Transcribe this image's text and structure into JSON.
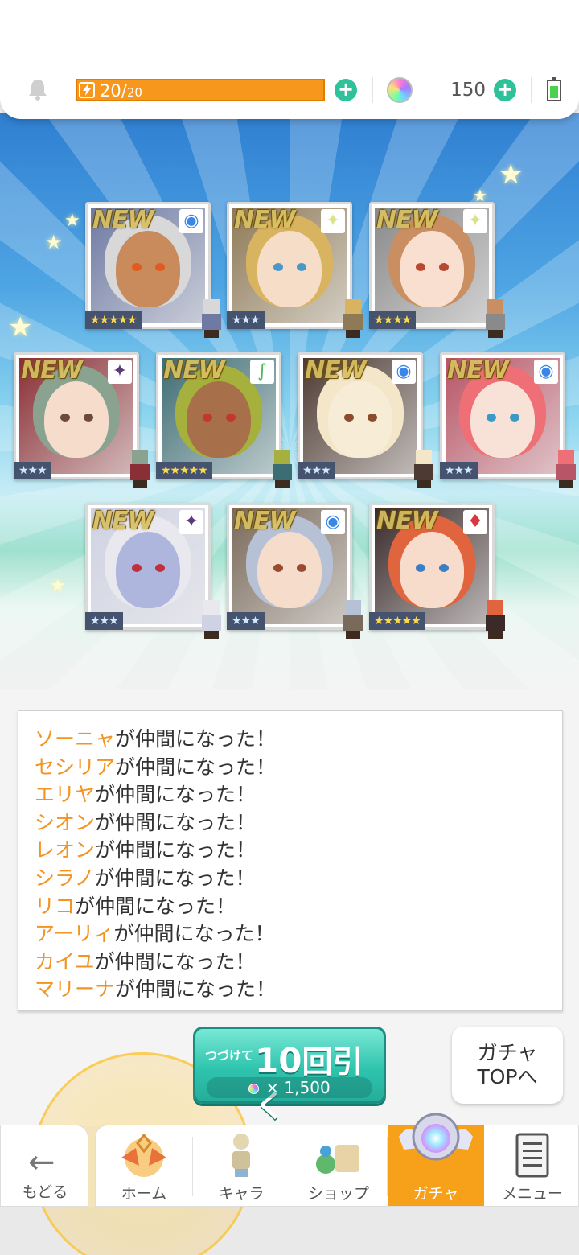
{
  "header": {
    "stamina_current": "20",
    "stamina_max": "20",
    "stamina_fraction": 1.0,
    "gem_count": "150",
    "icons": {
      "notification": "bell-icon",
      "stamina": "lightning-icon",
      "add_stamina": "plus-icon",
      "gem": "rainbow-gem-icon",
      "add_gem": "plus-icon",
      "battery": "battery-icon"
    },
    "colors": {
      "stamina_bar": "#f7981c",
      "plus": "#2fc29a",
      "battery": "#4bd14b"
    }
  },
  "results": {
    "cards": [
      {
        "new_label": "NEW",
        "stars": "★★★★★",
        "rarity": 5,
        "attribute": "circle-icon",
        "attr_glyph": "◉",
        "attr_color": "#3a86e8",
        "hair": "#d8d8d8",
        "skin": "#c98a5c",
        "eye": "#e35a20",
        "bg": "#6e7aa3"
      },
      {
        "new_label": "NEW",
        "stars": "★★★",
        "rarity": 3,
        "attribute": "sparkle-icon",
        "attr_glyph": "✦",
        "attr_color": "#dbe28a",
        "hair": "#d8b460",
        "skin": "#f6ddc8",
        "eye": "#4a98c9",
        "bg": "#8e7a57"
      },
      {
        "new_label": "NEW",
        "stars": "★★★★",
        "rarity": 4,
        "attribute": "sparkle-icon",
        "attr_glyph": "✦",
        "attr_color": "#dbe28a",
        "hair": "#c98e61",
        "skin": "#f8dfd0",
        "eye": "#b84830",
        "bg": "#8a8a8a"
      },
      {
        "new_label": "NEW",
        "stars": "★★★",
        "rarity": 3,
        "attribute": "star-purple-icon",
        "attr_glyph": "✦",
        "attr_color": "#5b3a7a",
        "hair": "#8aa391",
        "skin": "#f5dccb",
        "eye": "#6d4a3a",
        "bg": "#8a2f35"
      },
      {
        "new_label": "NEW",
        "stars": "★★★★★",
        "rarity": 5,
        "attribute": "leaf-icon",
        "attr_glyph": "∫",
        "attr_color": "#49b84e",
        "hair": "#a6b03c",
        "skin": "#a8704a",
        "eye": "#c0392b",
        "bg": "#3d6d74"
      },
      {
        "new_label": "NEW",
        "stars": "★★★",
        "rarity": 3,
        "attribute": "circle-icon",
        "attr_glyph": "◉",
        "attr_color": "#3a86e8",
        "hair": "#f3e6c9",
        "skin": "#f7ecd6",
        "eye": "#8c4a2e",
        "bg": "#4d3a32"
      },
      {
        "new_label": "NEW",
        "stars": "★★★",
        "rarity": 3,
        "attribute": "circle-icon",
        "attr_glyph": "◉",
        "attr_color": "#3a86e8",
        "hair": "#ef6f76",
        "skin": "#f8e2d8",
        "eye": "#3a99c5",
        "bg": "#b85566"
      },
      {
        "new_label": "NEW",
        "stars": "★★★",
        "rarity": 3,
        "attribute": "star-purple-icon",
        "attr_glyph": "✦",
        "attr_color": "#5b3a7a",
        "hair": "#e8e8ee",
        "skin": "#aeb6dd",
        "eye": "#c0303c",
        "bg": "#cfd2e2"
      },
      {
        "new_label": "NEW",
        "stars": "★★★",
        "rarity": 3,
        "attribute": "circle-icon",
        "attr_glyph": "◉",
        "attr_color": "#3a86e8",
        "hair": "#b7c1d6",
        "skin": "#f6dccb",
        "eye": "#9a4a30",
        "bg": "#7a6a5a"
      },
      {
        "new_label": "NEW",
        "stars": "★★★★★",
        "rarity": 5,
        "attribute": "diamond-red-icon",
        "attr_glyph": "♦",
        "attr_color": "#d9383f",
        "hair": "#e0643e",
        "skin": "#f8dccb",
        "eye": "#3a7fc5",
        "bg": "#3a2a2a"
      }
    ]
  },
  "messages": [
    {
      "name": "ソーニャ",
      "suffix": "が仲間になった！"
    },
    {
      "name": "セシリア",
      "suffix": "が仲間になった！"
    },
    {
      "name": "エリヤ",
      "suffix": "が仲間になった！"
    },
    {
      "name": "シオン",
      "suffix": "が仲間になった！"
    },
    {
      "name": "レオン",
      "suffix": "が仲間になった！"
    },
    {
      "name": "シラノ",
      "suffix": "が仲間になった！"
    },
    {
      "name": "リコ",
      "suffix": "が仲間になった！"
    },
    {
      "name": "アーリィ",
      "suffix": "が仲間になった！"
    },
    {
      "name": "カイユ",
      "suffix": "が仲間になった！"
    },
    {
      "name": "マリーナ",
      "suffix": "が仲間になった！"
    }
  ],
  "actions": {
    "pull_prefix": "つづけて",
    "pull_count": "10",
    "pull_suffix": "回引く",
    "pull_cost": "× 1,500",
    "top_button_line1": "ガチャ",
    "top_button_line2": "TOPへ"
  },
  "nav": {
    "back_label": "もどる",
    "items": [
      {
        "label": "ホーム",
        "icon": "home-icon",
        "active": false
      },
      {
        "label": "キャラ",
        "icon": "character-icon",
        "active": false
      },
      {
        "label": "ショップ",
        "icon": "shop-icon",
        "active": false
      },
      {
        "label": "ガチャ",
        "icon": "gacha-icon",
        "active": true
      },
      {
        "label": "メニュー",
        "icon": "menu-icon",
        "active": false
      }
    ],
    "active_color": "#f7a11a"
  }
}
